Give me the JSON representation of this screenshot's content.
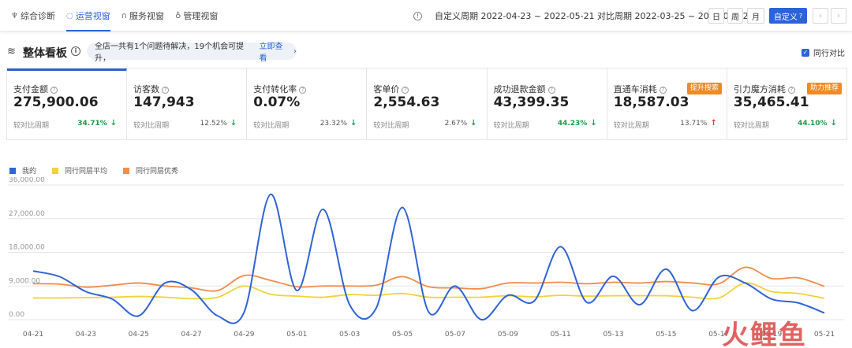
{
  "nav": {
    "items": [
      {
        "label": "综合诊断",
        "icon": "diagnosis-icon"
      },
      {
        "label": "运营视窗",
        "icon": "operations-icon"
      },
      {
        "label": "服务视窗",
        "icon": "headset-icon"
      },
      {
        "label": "管理视窗",
        "icon": "management-icon"
      }
    ],
    "active_index": 1
  },
  "period": {
    "text": "自定义周期 2022-04-23 ~ 2022-05-21 对比周期 2022-03-25 ~ 2022-04-22"
  },
  "period_buttons": {
    "day": "日",
    "week": "周",
    "month": "月",
    "custom": "自定义"
  },
  "board": {
    "title": "整体看板",
    "notice_text": "全店一共有1个问题待解决，19个机会可提升，",
    "notice_link": "立即查看",
    "peer_compare_label": "同行对比",
    "peer_compare_checked": true
  },
  "metrics": [
    {
      "label": "支付金额",
      "value": "275,900.06",
      "compare_label": "较对比周期",
      "pct": "34.71%",
      "direction": "down",
      "highlight": true,
      "tag": ""
    },
    {
      "label": "访客数",
      "value": "147,943",
      "compare_label": "较对比周期",
      "pct": "12.52%",
      "direction": "down",
      "highlight": false,
      "tag": ""
    },
    {
      "label": "支付转化率",
      "value": "0.07%",
      "compare_label": "较对比周期",
      "pct": "23.32%",
      "direction": "down",
      "highlight": false,
      "tag": ""
    },
    {
      "label": "客单价",
      "value": "2,554.63",
      "compare_label": "较对比周期",
      "pct": "2.67%",
      "direction": "down",
      "highlight": false,
      "tag": ""
    },
    {
      "label": "成功退款金额",
      "value": "43,399.35",
      "compare_label": "较对比周期",
      "pct": "44.23%",
      "direction": "down",
      "highlight": true,
      "tag": ""
    },
    {
      "label": "直通车消耗",
      "value": "18,587.03",
      "compare_label": "较对比周期",
      "pct": "13.71%",
      "direction": "up",
      "highlight": false,
      "tag": "提升搜索"
    },
    {
      "label": "引力魔方消耗",
      "value": "35,465.41",
      "compare_label": "较对比周期",
      "pct": "44.10%",
      "direction": "down",
      "highlight": true,
      "tag": "助力推荐"
    }
  ],
  "colors": {
    "accent": "#2b63d9",
    "good": "#1a9a4a",
    "bad": "#e0343a",
    "tag": "#f08a24"
  },
  "chart_data": {
    "type": "line",
    "x": [
      "04-21",
      "04-22",
      "04-23",
      "04-24",
      "04-25",
      "04-26",
      "04-27",
      "04-28",
      "04-29",
      "04-30",
      "05-01",
      "05-02",
      "05-03",
      "05-04",
      "05-05",
      "05-06",
      "05-07",
      "05-08",
      "05-09",
      "05-10",
      "05-11",
      "05-12",
      "05-13",
      "05-14",
      "05-15",
      "05-16",
      "05-17",
      "05-18",
      "05-19",
      "05-20",
      "05-21"
    ],
    "x_tick_labels": [
      "04-21",
      "04-23",
      "04-25",
      "04-27",
      "04-29",
      "05-01",
      "05-03",
      "05-05",
      "05-07",
      "05-09",
      "05-11",
      "05-13",
      "05-15",
      "05-17",
      "05-19",
      "05-21"
    ],
    "y_tick_labels": [
      "0.00",
      "9,000.00",
      "18,000.00",
      "27,000.00",
      "36,000.00"
    ],
    "ylim": [
      0,
      36000
    ],
    "grid": true,
    "legend_position": "top-left",
    "series": [
      {
        "name": "我的",
        "color": "#2f63d6",
        "values": [
          13000,
          11500,
          7500,
          5500,
          1000,
          9800,
          8000,
          1000,
          2000,
          33500,
          7800,
          29500,
          4000,
          3000,
          30000,
          2000,
          9000,
          0,
          6500,
          5000,
          19500,
          4600,
          11600,
          4000,
          13500,
          2400,
          11400,
          9800,
          5500,
          4500,
          1800
        ]
      },
      {
        "name": "同行同层平均",
        "color": "#f2d23a",
        "values": [
          5800,
          5800,
          5900,
          6000,
          6200,
          6000,
          5600,
          6000,
          9000,
          6800,
          6300,
          6000,
          6700,
          6500,
          7000,
          6000,
          6000,
          6000,
          6400,
          6100,
          6500,
          6300,
          6400,
          6400,
          6400,
          6000,
          5800,
          9800,
          7500,
          7000,
          5700
        ]
      },
      {
        "name": "同行同层优秀",
        "color": "#f38b4b",
        "values": [
          9600,
          9500,
          8700,
          9200,
          9800,
          9000,
          8500,
          7800,
          11800,
          10500,
          8800,
          9000,
          9000,
          9200,
          11500,
          8800,
          8500,
          8300,
          9800,
          9800,
          10000,
          9600,
          10000,
          9800,
          10200,
          9800,
          9600,
          14000,
          11000,
          11200,
          8900
        ]
      }
    ]
  },
  "watermark": "火鲤鱼"
}
